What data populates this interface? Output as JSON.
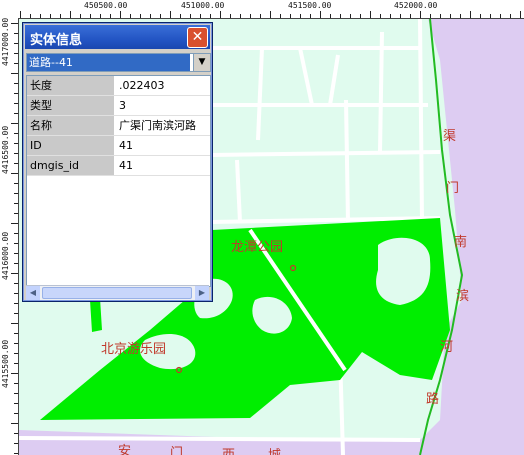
{
  "ruler": {
    "x_labels": [
      "450500.00",
      "451000.00",
      "451500.00",
      "452000.00"
    ],
    "y_labels": [
      "4417000.00",
      "4416500.00",
      "4416000.00",
      "4415500.00"
    ]
  },
  "map": {
    "labels": {
      "longtan_park": "龙潭公园",
      "beijing_amusement": "北京游乐园",
      "river_chars": [
        "渠",
        "门",
        "南",
        "滨",
        "河",
        "路"
      ],
      "bottom_chars": [
        "安",
        "门",
        "西",
        "城"
      ]
    },
    "colors": {
      "park": "#00ee00",
      "background": "#e0fbee",
      "district": "#ddccf2",
      "road": "#ffffff",
      "river_line": "#22bb22"
    }
  },
  "info_window": {
    "title": "实体信息",
    "close_label": "✕",
    "selected_entity": "道路--41",
    "properties": [
      {
        "key": "长度",
        "value": ".022403"
      },
      {
        "key": "类型",
        "value": "3"
      },
      {
        "key": "名称",
        "value": "广渠门南滨河路"
      },
      {
        "key": "ID",
        "value": "41"
      },
      {
        "key": "dmgis_id",
        "value": "41"
      }
    ]
  }
}
